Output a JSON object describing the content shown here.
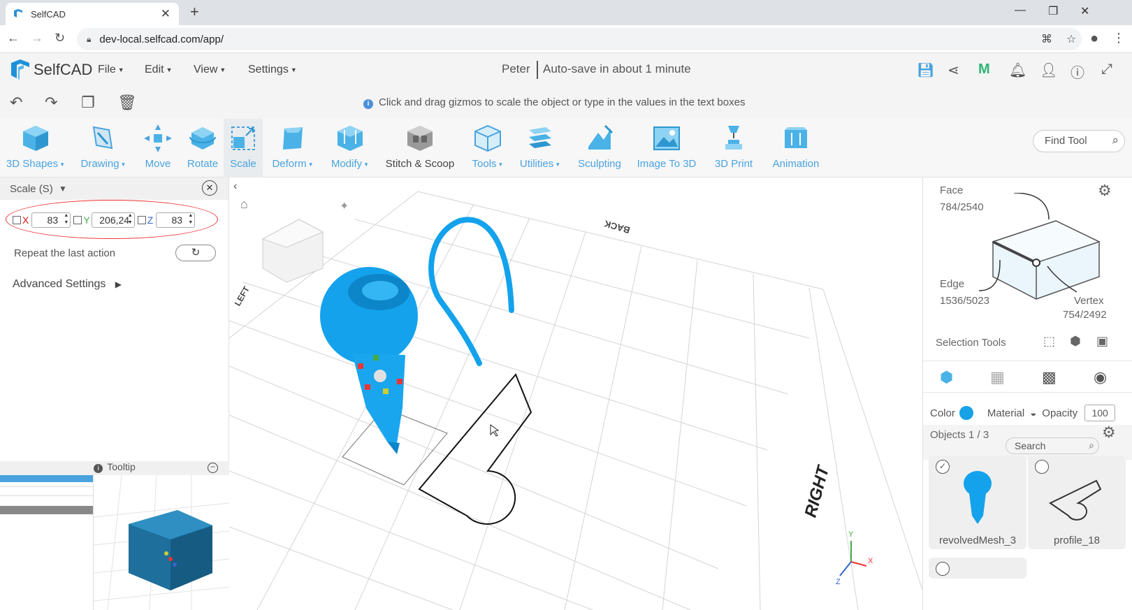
{
  "browser": {
    "tab_title": "SelfCAD",
    "url": "dev-local.selfcad.com/app/"
  },
  "app": {
    "brand": "SelfCAD",
    "menus": [
      "File",
      "Edit",
      "View",
      "Settings"
    ],
    "user": "Peter",
    "autosave": "Auto-save in about 1 minute",
    "hint": "Click and drag gizmos to scale the object or type in the values in the text boxes"
  },
  "toolbar": {
    "tools": [
      {
        "label": "3D Shapes",
        "caret": true
      },
      {
        "label": "Drawing",
        "caret": true
      },
      {
        "label": "Move",
        "caret": false
      },
      {
        "label": "Rotate",
        "caret": false
      },
      {
        "label": "Scale",
        "caret": false
      },
      {
        "label": "Deform",
        "caret": true
      },
      {
        "label": "Modify",
        "caret": true
      },
      {
        "label": "Stitch & Scoop",
        "caret": false
      },
      {
        "label": "Tools",
        "caret": true
      },
      {
        "label": "Utilities",
        "caret": true
      },
      {
        "label": "Sculpting",
        "caret": false
      },
      {
        "label": "Image To 3D",
        "caret": false
      },
      {
        "label": "3D Print",
        "caret": false
      },
      {
        "label": "Animation",
        "caret": false
      }
    ],
    "find_tool": "Find Tool"
  },
  "scale_panel": {
    "title": "Scale (S)",
    "x_label": "X",
    "x_value": "83",
    "y_label": "Y",
    "y_value": "206,24",
    "z_label": "Z",
    "z_value": "83",
    "repeat_label": "Repeat the last action",
    "advanced_label": "Advanced Settings",
    "tooltip_label": "Tooltip"
  },
  "viewport": {
    "label_back": "BACK",
    "label_right": "RIGHT",
    "label_left": "LEFT",
    "axis_x": "X",
    "axis_y": "Y",
    "axis_z": "Z"
  },
  "right_panel": {
    "face_label": "Face",
    "face_count": "784/2540",
    "edge_label": "Edge",
    "edge_count": "1536/5023",
    "vertex_label": "Vertex",
    "vertex_count": "754/2492",
    "selection_tools": "Selection Tools",
    "color_label": "Color",
    "material_label": "Material",
    "opacity_label": "Opacity",
    "opacity_value": "100",
    "objects_label": "Objects 1 / 3",
    "search_placeholder": "Search",
    "objects": [
      {
        "name": "revolvedMesh_3",
        "checked": true
      },
      {
        "name": "profile_18",
        "checked": false
      },
      {
        "name": "",
        "checked": false
      }
    ]
  },
  "colors": {
    "accent": "#4aa3df",
    "object_blue": "#17a2e8",
    "highlight_red": "#e33333"
  }
}
